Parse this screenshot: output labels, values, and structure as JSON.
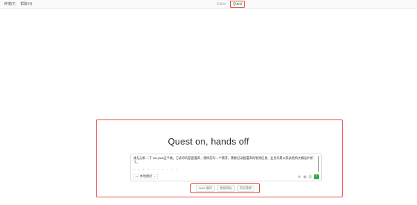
{
  "menu": {
    "items": [
      "终端(T)",
      "帮助(H)"
    ]
  },
  "modes": {
    "items": [
      "Editor",
      "Quest"
    ],
    "active": "Quest"
  },
  "main": {
    "headline": "Quest on, hands off",
    "composer": {
      "prompt_text": "请先分析一下 xxx.java这个类。它表示的是配置库，我目前有一个需求，需要记录配置库的物流信息，业务背景以及表结构大概设计如下。",
      "dots": "· · · · · · · · · ·",
      "mode_label": "本地模式",
      "tool_icons": [
        "settings-icon",
        "image-icon",
        "at-icon"
      ],
      "send_icon": "send-icon"
    },
    "suggestions": [
      "Java 编译",
      "根据网站",
      "浏览需要"
    ]
  },
  "colors": {
    "highlight_border": "#e53935",
    "send_button": "#2eaa4a",
    "active_mode": "#1a7f37"
  }
}
